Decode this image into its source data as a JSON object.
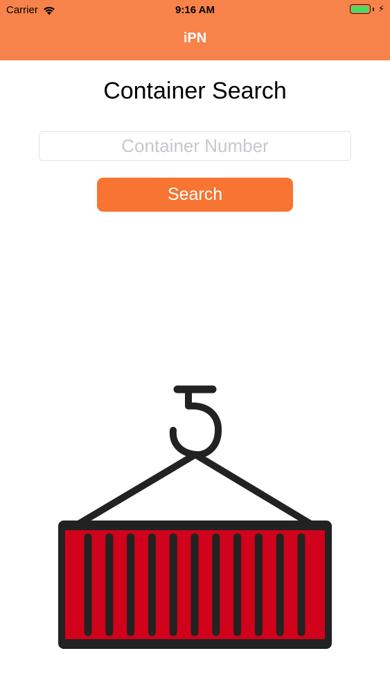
{
  "status_bar": {
    "carrier": "Carrier",
    "time": "9:16 AM",
    "wifi_icon": "wifi-icon",
    "battery_icon": "battery-icon",
    "battery_level": 1.0,
    "charging_icon": "bolt-icon"
  },
  "nav": {
    "title": "iPN"
  },
  "main": {
    "title": "Container Search",
    "input_placeholder": "Container Number",
    "input_value": "",
    "search_label": "Search",
    "illustration_icon": "hanging-shipping-container-icon"
  },
  "colors": {
    "nav_bar": "#F7834B",
    "search_button": "#F77433",
    "container_red": "#D0021B",
    "outline": "#222222",
    "battery_green": "#4CD964"
  }
}
